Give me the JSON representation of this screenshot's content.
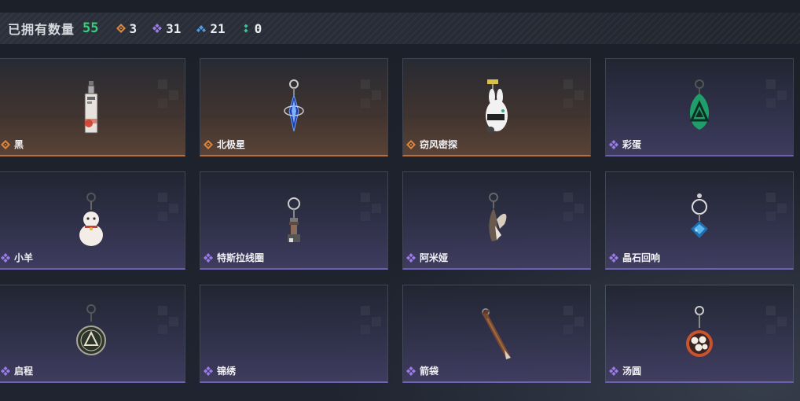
{
  "header": {
    "title": "已拥有数量",
    "total": "55",
    "rarities": [
      {
        "icon": "orange-diamond-icon",
        "color": "#d8853f",
        "count": "3"
      },
      {
        "icon": "purple-diamond-icon",
        "color": "#9a7be8",
        "count": "31"
      },
      {
        "icon": "blue-diamond-icon",
        "color": "#4f9be6",
        "count": "21"
      },
      {
        "icon": "green-diamond-icon",
        "color": "#3cc79a",
        "count": "0"
      }
    ]
  },
  "charms": [
    {
      "name": "黑",
      "rarity": "orange",
      "art": "tag-charm"
    },
    {
      "name": "北极星",
      "rarity": "orange",
      "art": "star-charm"
    },
    {
      "name": "窃风密探",
      "rarity": "orange",
      "art": "rabbit-charm"
    },
    {
      "name": "彩蛋",
      "rarity": "purple",
      "art": "egg-charm"
    },
    {
      "name": "小羊",
      "rarity": "purple",
      "art": "sheep-charm"
    },
    {
      "name": "特斯拉线圈",
      "rarity": "purple",
      "art": "coil-charm"
    },
    {
      "name": "阿米娅",
      "rarity": "purple",
      "art": "bunny-ear-charm"
    },
    {
      "name": "晶石回响",
      "rarity": "purple",
      "art": "crystal-charm"
    },
    {
      "name": "启程",
      "rarity": "purple",
      "art": "medal-charm"
    },
    {
      "name": "锦绣",
      "rarity": "purple",
      "art": "empty"
    },
    {
      "name": "箭袋",
      "rarity": "purple",
      "art": "arrow-charm"
    },
    {
      "name": "汤圆",
      "rarity": "purple",
      "art": "dumpling-charm"
    }
  ]
}
